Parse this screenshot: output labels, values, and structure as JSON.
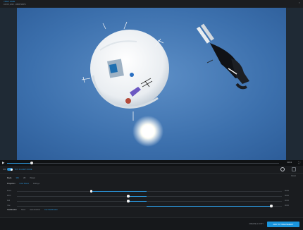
{
  "header": {
    "title": "VIDEO NAME",
    "subtitle": "JAN 15, 2019 · 1080P 60FPS"
  },
  "player": {
    "time": "00:13",
    "progress": 0.09
  },
  "panel": {
    "toggle_left": "360",
    "toggle_right": "TINY PLANET MODE",
    "reset_label": "Reset",
    "mode": {
      "label": "Mode",
      "options": [
        "360",
        "VR",
        "Planet"
      ],
      "active": 0
    },
    "projection": {
      "label": "Projection",
      "options": [
        "Little Planet",
        "Fisheye"
      ],
      "active": 0
    },
    "sliders": [
      {
        "name": "Zoom",
        "value": "00:00",
        "level": 0.28,
        "seg": [
          0.28,
          0.49
        ]
      },
      {
        "name": "Pitch",
        "value": "00:00",
        "level": 0.42,
        "seg": [
          0.42,
          0.49
        ]
      },
      {
        "name": "Roll",
        "value": "00:00",
        "level": 0.42,
        "seg": [
          0.42,
          0.49
        ]
      },
      {
        "name": "Yaw",
        "value": "00:00",
        "level": 0.96,
        "seg": [
          0.49,
          0.96
        ]
      }
    ],
    "stabilization": {
      "label": "Stabilization",
      "options": [
        "None",
        "Auto Horizon",
        "Full Stabilization"
      ],
      "active": 2
    }
  },
  "footer": {
    "secondary_label": "CREATE A COPY",
    "primary_label": "ADD TO TIMELINE/EDIT"
  },
  "colors": {
    "accent": "#2a8fd0",
    "primary_button": "#1a95dd",
    "sky": "#3f75b5"
  }
}
